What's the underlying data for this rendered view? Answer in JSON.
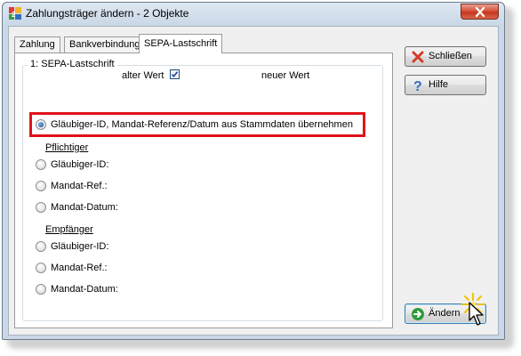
{
  "window": {
    "title": "Zahlungsträger ändern - 2 Objekte"
  },
  "tabs": [
    {
      "label": "Zahlung",
      "active": false
    },
    {
      "label": "Bankverbindung",
      "active": false
    },
    {
      "label": "SEPA-Lastschrift",
      "active": true
    }
  ],
  "group": {
    "title": "1: SEPA-Lastschrift",
    "old_value_label": "alter Wert",
    "old_value_checked": true,
    "new_value_label": "neuer Wert"
  },
  "options": {
    "take_from_master": "Gläubiger-ID, Mandat-Referenz/Datum aus Stammdaten übernehmen",
    "debtor_section": "Pflichtiger",
    "debtor_creditor_id": "Gläubiger-ID:",
    "debtor_mandate_ref": "Mandat-Ref.:",
    "debtor_mandate_date": "Mandat-Datum:",
    "payee_section": "Empfänger",
    "payee_creditor_id": "Gläubiger-ID:",
    "payee_mandate_ref": "Mandat-Ref.:",
    "payee_mandate_date": "Mandat-Datum:"
  },
  "buttons": {
    "close": "Schließen",
    "help": "Hilfe",
    "apply": "Ändern"
  },
  "colors": {
    "highlight": "#e0131a",
    "close_icon": "#d23c2a",
    "help_icon": "#2f6fbf",
    "apply_icon": "#2e9a3c"
  }
}
